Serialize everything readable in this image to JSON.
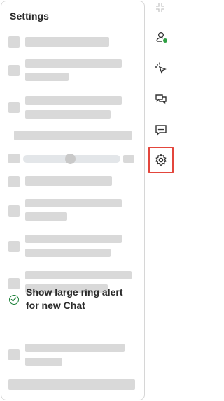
{
  "panel": {
    "title": "Settings"
  },
  "ring_alert": {
    "label_line1": "Show large ring alert",
    "label_line2": "for new Chat",
    "checked": true
  },
  "rail": {
    "items": [
      {
        "icon": "person-online-icon"
      },
      {
        "icon": "cursor-sparkle-icon"
      },
      {
        "icon": "chat-bubbles-icon"
      },
      {
        "icon": "message-dots-icon"
      },
      {
        "icon": "gear-icon",
        "active": true
      }
    ]
  },
  "colors": {
    "accent_green": "#1a7f37",
    "active_border": "#e3463c",
    "skeleton": "#d9d9d9"
  }
}
